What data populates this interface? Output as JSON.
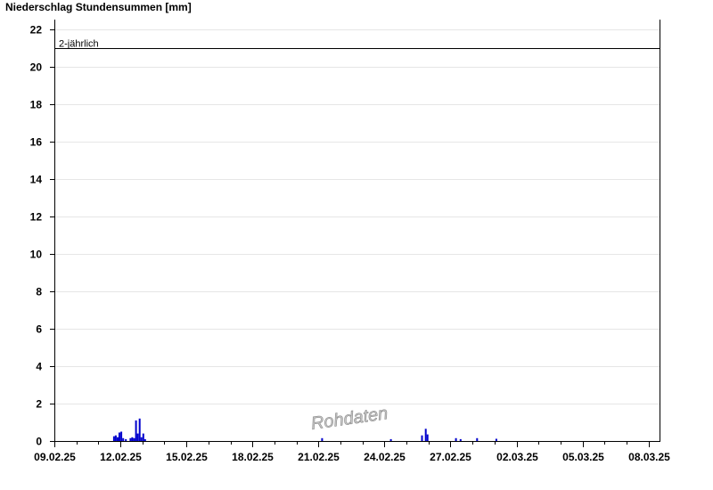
{
  "chart_data": {
    "type": "bar",
    "title": "Niederschlag Stundensummen [mm]",
    "xlabel": "",
    "ylabel": "",
    "ylim": [
      0,
      22.5
    ],
    "yticks": [
      0,
      2,
      4,
      6,
      8,
      10,
      12,
      14,
      16,
      18,
      20,
      22
    ],
    "xlim": [
      "09.02.25 00:00",
      "08.03.25 12:00"
    ],
    "xticks": [
      "09.02.25",
      "12.02.25",
      "15.02.25",
      "18.02.25",
      "21.02.25",
      "24.02.25",
      "27.02.25",
      "02.03.25",
      "05.03.25",
      "08.03.25"
    ],
    "grid": true,
    "threshold": {
      "label": "2-jährlich",
      "value": 21
    },
    "watermark": "Rohdaten",
    "bar_color": "#0000cc",
    "series": [
      {
        "values": [
          [
            "11.02.25 17:00",
            0.25
          ],
          [
            "11.02.25 19:00",
            0.3
          ],
          [
            "11.02.25 21:00",
            0.2
          ],
          [
            "11.02.25 23:00",
            0.45
          ],
          [
            "12.02.25 01:00",
            0.5
          ],
          [
            "12.02.25 03:00",
            0.15
          ],
          [
            "12.02.25 06:00",
            0.1
          ],
          [
            "12.02.25 11:00",
            0.15
          ],
          [
            "12.02.25 13:00",
            0.2
          ],
          [
            "12.02.25 15:00",
            0.15
          ],
          [
            "12.02.25 17:00",
            1.1
          ],
          [
            "12.02.25 19:00",
            0.4
          ],
          [
            "12.02.25 21:00",
            1.2
          ],
          [
            "12.02.25 23:00",
            0.2
          ],
          [
            "13.02.25 01:00",
            0.4
          ],
          [
            "13.02.25 03:00",
            0.1
          ],
          [
            "21.02.25 04:00",
            0.15
          ],
          [
            "24.02.25 07:00",
            0.1
          ],
          [
            "25.02.25 17:00",
            0.3
          ],
          [
            "25.02.25 21:00",
            0.65
          ],
          [
            "25.02.25 23:00",
            0.35
          ],
          [
            "27.02.25 06:00",
            0.15
          ],
          [
            "27.02.25 11:00",
            0.1
          ],
          [
            "28.02.25 05:00",
            0.15
          ],
          [
            "01.03.25 02:00",
            0.12
          ]
        ]
      }
    ]
  }
}
